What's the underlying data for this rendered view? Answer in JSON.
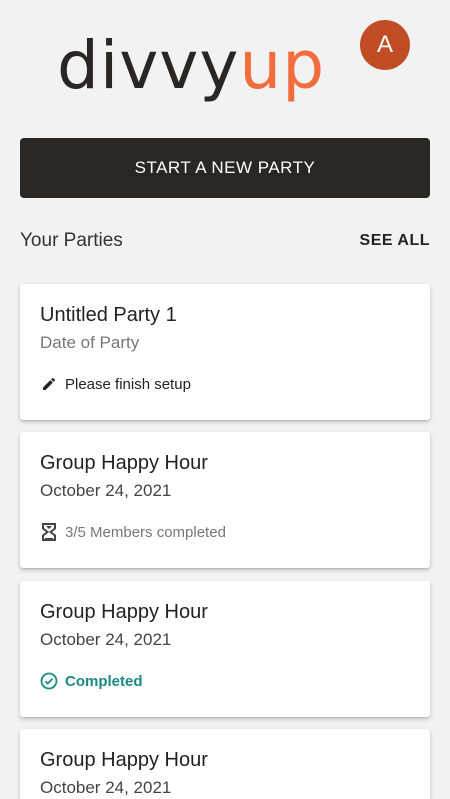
{
  "app": {
    "logo_part1": "divvy",
    "logo_part2": "up",
    "avatar_initial": "A",
    "accent_color": "#f26d3d",
    "dark_color": "#2a2626"
  },
  "actions": {
    "start_party_label": "START A NEW PARTY"
  },
  "parties_section": {
    "title": "Your Parties",
    "see_all_label": "SEE ALL"
  },
  "parties": [
    {
      "title": "Untitled Party 1",
      "date": "Date of Party",
      "status": "Please finish setup",
      "status_type": "setup",
      "status_icon": "pencil-icon"
    },
    {
      "title": "Group Happy Hour",
      "date": "October 24, 2021",
      "status": "3/5 Members completed",
      "status_type": "progress",
      "status_icon": "hourglass-icon"
    },
    {
      "title": "Group Happy Hour",
      "date": "October 24, 2021",
      "status": "Completed",
      "status_type": "done",
      "status_icon": "check-circle-icon",
      "status_color": "#1a8a85"
    },
    {
      "title": "Group Happy Hour",
      "date": "October 24, 2021"
    }
  ]
}
